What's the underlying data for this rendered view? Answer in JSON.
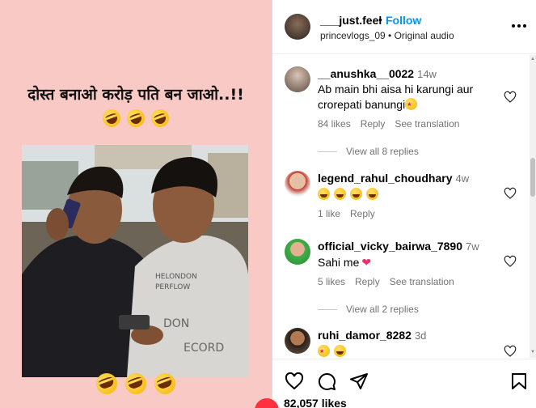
{
  "post": {
    "caption": "दोस्त बनाओ करोड़ पति बन जाओ..!!",
    "author": "___just.feel",
    "follow_label": "Follow",
    "dot": "•",
    "subtitle": "princevlogs_09 • Original audio"
  },
  "comments": [
    {
      "username": "__anushka__0022",
      "time": "14w",
      "text": "Ab main bhi aisa hi karungi aur crorepati banungi",
      "likes": "84 likes",
      "reply": "Reply",
      "translation": "See translation",
      "view_replies": "View all 8 replies"
    },
    {
      "username": "legend_rahul_choudhary",
      "time": "4w",
      "text": "",
      "likes": "1 like",
      "reply": "Reply"
    },
    {
      "username": "official_vicky_bairwa_7890",
      "time": "7w",
      "text": "Sahi me",
      "likes": "5 likes",
      "reply": "Reply",
      "translation": "See translation",
      "view_replies": "View all 2 replies"
    },
    {
      "username": "ruhi_damor_8282",
      "time": "3d",
      "text": ""
    }
  ],
  "footer": {
    "likes_count": "82,057 likes"
  },
  "icons": {
    "like": "heart-icon",
    "comment": "comment-icon",
    "share": "send-icon",
    "save": "bookmark-icon",
    "more": "more-options-icon"
  },
  "colors": {
    "accent": "#0095f6",
    "media_bg": "#f9c9c6",
    "muted": "#737373"
  }
}
